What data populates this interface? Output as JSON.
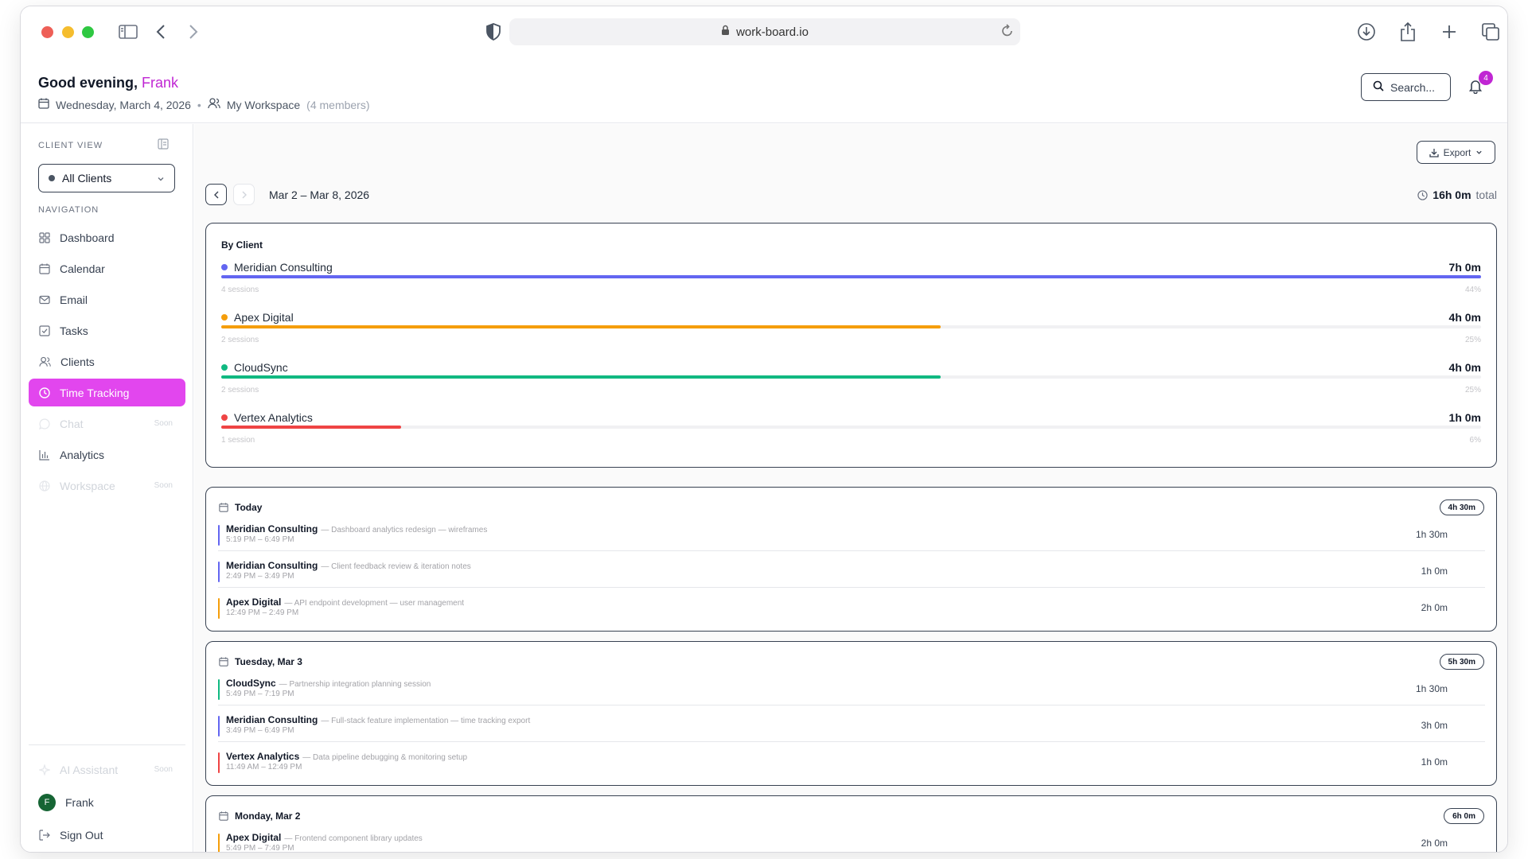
{
  "browser": {
    "url": "work-board.io"
  },
  "header": {
    "greeting": "Good evening,",
    "user_name": "Frank",
    "date": "Wednesday, March 4, 2026",
    "workspace": "My Workspace",
    "members": "(4 members)",
    "search_label": "Search...",
    "notification_count": "4"
  },
  "sidebar": {
    "client_view_label": "CLIENT VIEW",
    "client_select": "All Clients",
    "navigation_label": "NAVIGATION",
    "items": [
      {
        "label": "Dashboard",
        "icon": "grid-icon"
      },
      {
        "label": "Calendar",
        "icon": "calendar-icon"
      },
      {
        "label": "Email",
        "icon": "mail-icon"
      },
      {
        "label": "Tasks",
        "icon": "checkbox-icon"
      },
      {
        "label": "Clients",
        "icon": "users-icon"
      },
      {
        "label": "Time Tracking",
        "icon": "clock-icon",
        "active": true
      },
      {
        "label": "Chat",
        "icon": "chat-icon",
        "badge": "Soon",
        "disabled": true
      },
      {
        "label": "Analytics",
        "icon": "bar-chart-icon"
      },
      {
        "label": "Workspace",
        "icon": "globe-icon",
        "badge": "Soon",
        "disabled": true
      }
    ],
    "ai_assistant": {
      "label": "AI Assistant",
      "badge": "Soon"
    },
    "user": {
      "initial": "F",
      "name": "Frank"
    },
    "sign_out": "Sign Out"
  },
  "main": {
    "export_label": "Export",
    "week_range": "Mar 2 – Mar 8, 2026",
    "total_hours": "16h 0m",
    "total_suffix": "total",
    "by_client": {
      "title": "By Client",
      "clients": [
        {
          "name": "Meridian Consulting",
          "hours": "7h 0m",
          "sessions": "4 sessions",
          "percent": "44%",
          "share": 1.0,
          "color": "#6366f1"
        },
        {
          "name": "Apex Digital",
          "hours": "4h 0m",
          "sessions": "2 sessions",
          "percent": "25%",
          "share": 0.571,
          "color": "#f59e0b"
        },
        {
          "name": "CloudSync",
          "hours": "4h 0m",
          "sessions": "2 sessions",
          "percent": "25%",
          "share": 0.571,
          "color": "#10b981"
        },
        {
          "name": "Vertex Analytics",
          "hours": "1h 0m",
          "sessions": "1 session",
          "percent": "6%",
          "share": 0.143,
          "color": "#ef4444"
        }
      ]
    },
    "days": [
      {
        "label": "Today",
        "total": "4h 30m",
        "entries": [
          {
            "client": "Meridian Consulting",
            "desc": "— Dashboard analytics redesign — wireframes",
            "time": "5:19 PM – 6:49 PM",
            "duration": "1h 30m",
            "color": "#6366f1"
          },
          {
            "client": "Meridian Consulting",
            "desc": "— Client feedback review & iteration notes",
            "time": "2:49 PM – 3:49 PM",
            "duration": "1h 0m",
            "color": "#6366f1"
          },
          {
            "client": "Apex Digital",
            "desc": "— API endpoint development — user management",
            "time": "12:49 PM – 2:49 PM",
            "duration": "2h 0m",
            "color": "#f59e0b"
          }
        ]
      },
      {
        "label": "Tuesday, Mar 3",
        "total": "5h 30m",
        "entries": [
          {
            "client": "CloudSync",
            "desc": "— Partnership integration planning session",
            "time": "5:49 PM – 7:19 PM",
            "duration": "1h 30m",
            "color": "#10b981"
          },
          {
            "client": "Meridian Consulting",
            "desc": "— Full-stack feature implementation — time tracking export",
            "time": "3:49 PM – 6:49 PM",
            "duration": "3h 0m",
            "color": "#6366f1"
          },
          {
            "client": "Vertex Analytics",
            "desc": "— Data pipeline debugging & monitoring setup",
            "time": "11:49 AM – 12:49 PM",
            "duration": "1h 0m",
            "color": "#ef4444"
          }
        ]
      },
      {
        "label": "Monday, Mar 2",
        "total": "6h 0m",
        "entries": [
          {
            "client": "Apex Digital",
            "desc": "— Frontend component library updates",
            "time": "5:49 PM – 7:49 PM",
            "duration": "2h 0m",
            "color": "#f59e0b"
          }
        ]
      }
    ]
  }
}
